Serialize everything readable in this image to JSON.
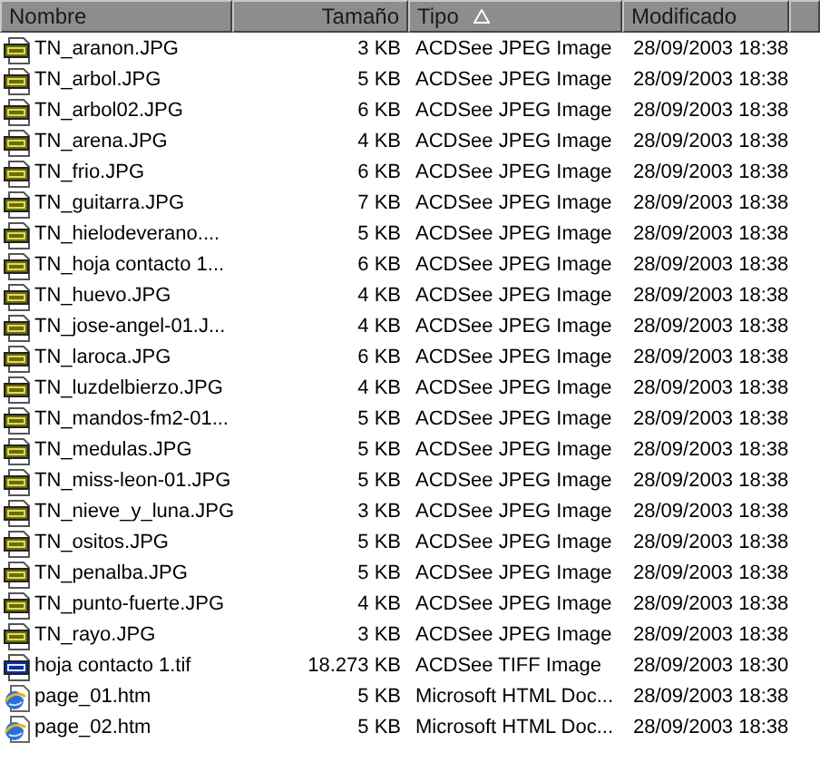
{
  "columns": [
    {
      "label": "Nombre",
      "sorted": false
    },
    {
      "label": "Tamaño",
      "sorted": false
    },
    {
      "label": "Tipo",
      "sorted": true
    },
    {
      "label": "Modificado",
      "sorted": false
    }
  ],
  "rows": [
    {
      "kind": "jpg",
      "name": "TN_aranon.JPG",
      "size": "3 KB",
      "type": "ACDSee JPEG Image",
      "modified": "28/09/2003 18:38"
    },
    {
      "kind": "jpg",
      "name": "TN_arbol.JPG",
      "size": "5 KB",
      "type": "ACDSee JPEG Image",
      "modified": "28/09/2003 18:38"
    },
    {
      "kind": "jpg",
      "name": "TN_arbol02.JPG",
      "size": "6 KB",
      "type": "ACDSee JPEG Image",
      "modified": "28/09/2003 18:38"
    },
    {
      "kind": "jpg",
      "name": "TN_arena.JPG",
      "size": "4 KB",
      "type": "ACDSee JPEG Image",
      "modified": "28/09/2003 18:38"
    },
    {
      "kind": "jpg",
      "name": "TN_frio.JPG",
      "size": "6 KB",
      "type": "ACDSee JPEG Image",
      "modified": "28/09/2003 18:38"
    },
    {
      "kind": "jpg",
      "name": "TN_guitarra.JPG",
      "size": "7 KB",
      "type": "ACDSee JPEG Image",
      "modified": "28/09/2003 18:38"
    },
    {
      "kind": "jpg",
      "name": "TN_hielodeverano....",
      "size": "5 KB",
      "type": "ACDSee JPEG Image",
      "modified": "28/09/2003 18:38"
    },
    {
      "kind": "jpg",
      "name": "TN_hoja contacto 1...",
      "size": "6 KB",
      "type": "ACDSee JPEG Image",
      "modified": "28/09/2003 18:38"
    },
    {
      "kind": "jpg",
      "name": "TN_huevo.JPG",
      "size": "4 KB",
      "type": "ACDSee JPEG Image",
      "modified": "28/09/2003 18:38"
    },
    {
      "kind": "jpg",
      "name": "TN_jose-angel-01.J...",
      "size": "4 KB",
      "type": "ACDSee JPEG Image",
      "modified": "28/09/2003 18:38"
    },
    {
      "kind": "jpg",
      "name": "TN_laroca.JPG",
      "size": "6 KB",
      "type": "ACDSee JPEG Image",
      "modified": "28/09/2003 18:38"
    },
    {
      "kind": "jpg",
      "name": "TN_luzdelbierzo.JPG",
      "size": "4 KB",
      "type": "ACDSee JPEG Image",
      "modified": "28/09/2003 18:38"
    },
    {
      "kind": "jpg",
      "name": "TN_mandos-fm2-01...",
      "size": "5 KB",
      "type": "ACDSee JPEG Image",
      "modified": "28/09/2003 18:38"
    },
    {
      "kind": "jpg",
      "name": "TN_medulas.JPG",
      "size": "5 KB",
      "type": "ACDSee JPEG Image",
      "modified": "28/09/2003 18:38"
    },
    {
      "kind": "jpg",
      "name": "TN_miss-leon-01.JPG",
      "size": "5 KB",
      "type": "ACDSee JPEG Image",
      "modified": "28/09/2003 18:38"
    },
    {
      "kind": "jpg",
      "name": "TN_nieve_y_luna.JPG",
      "size": "3 KB",
      "type": "ACDSee JPEG Image",
      "modified": "28/09/2003 18:38"
    },
    {
      "kind": "jpg",
      "name": "TN_ositos.JPG",
      "size": "5 KB",
      "type": "ACDSee JPEG Image",
      "modified": "28/09/2003 18:38"
    },
    {
      "kind": "jpg",
      "name": "TN_penalba.JPG",
      "size": "5 KB",
      "type": "ACDSee JPEG Image",
      "modified": "28/09/2003 18:38"
    },
    {
      "kind": "jpg",
      "name": "TN_punto-fuerte.JPG",
      "size": "4 KB",
      "type": "ACDSee JPEG Image",
      "modified": "28/09/2003 18:38"
    },
    {
      "kind": "jpg",
      "name": "TN_rayo.JPG",
      "size": "3 KB",
      "type": "ACDSee JPEG Image",
      "modified": "28/09/2003 18:38"
    },
    {
      "kind": "tif",
      "name": "hoja contacto 1.tif",
      "size": "18.273 KB",
      "type": "ACDSee TIFF Image",
      "modified": "28/09/2003 18:30"
    },
    {
      "kind": "htm",
      "name": "page_01.htm",
      "size": "5 KB",
      "type": "Microsoft HTML Doc...",
      "modified": "28/09/2003 18:38"
    },
    {
      "kind": "htm",
      "name": "page_02.htm",
      "size": "5 KB",
      "type": "Microsoft HTML Doc...",
      "modified": "28/09/2003 18:38"
    }
  ]
}
